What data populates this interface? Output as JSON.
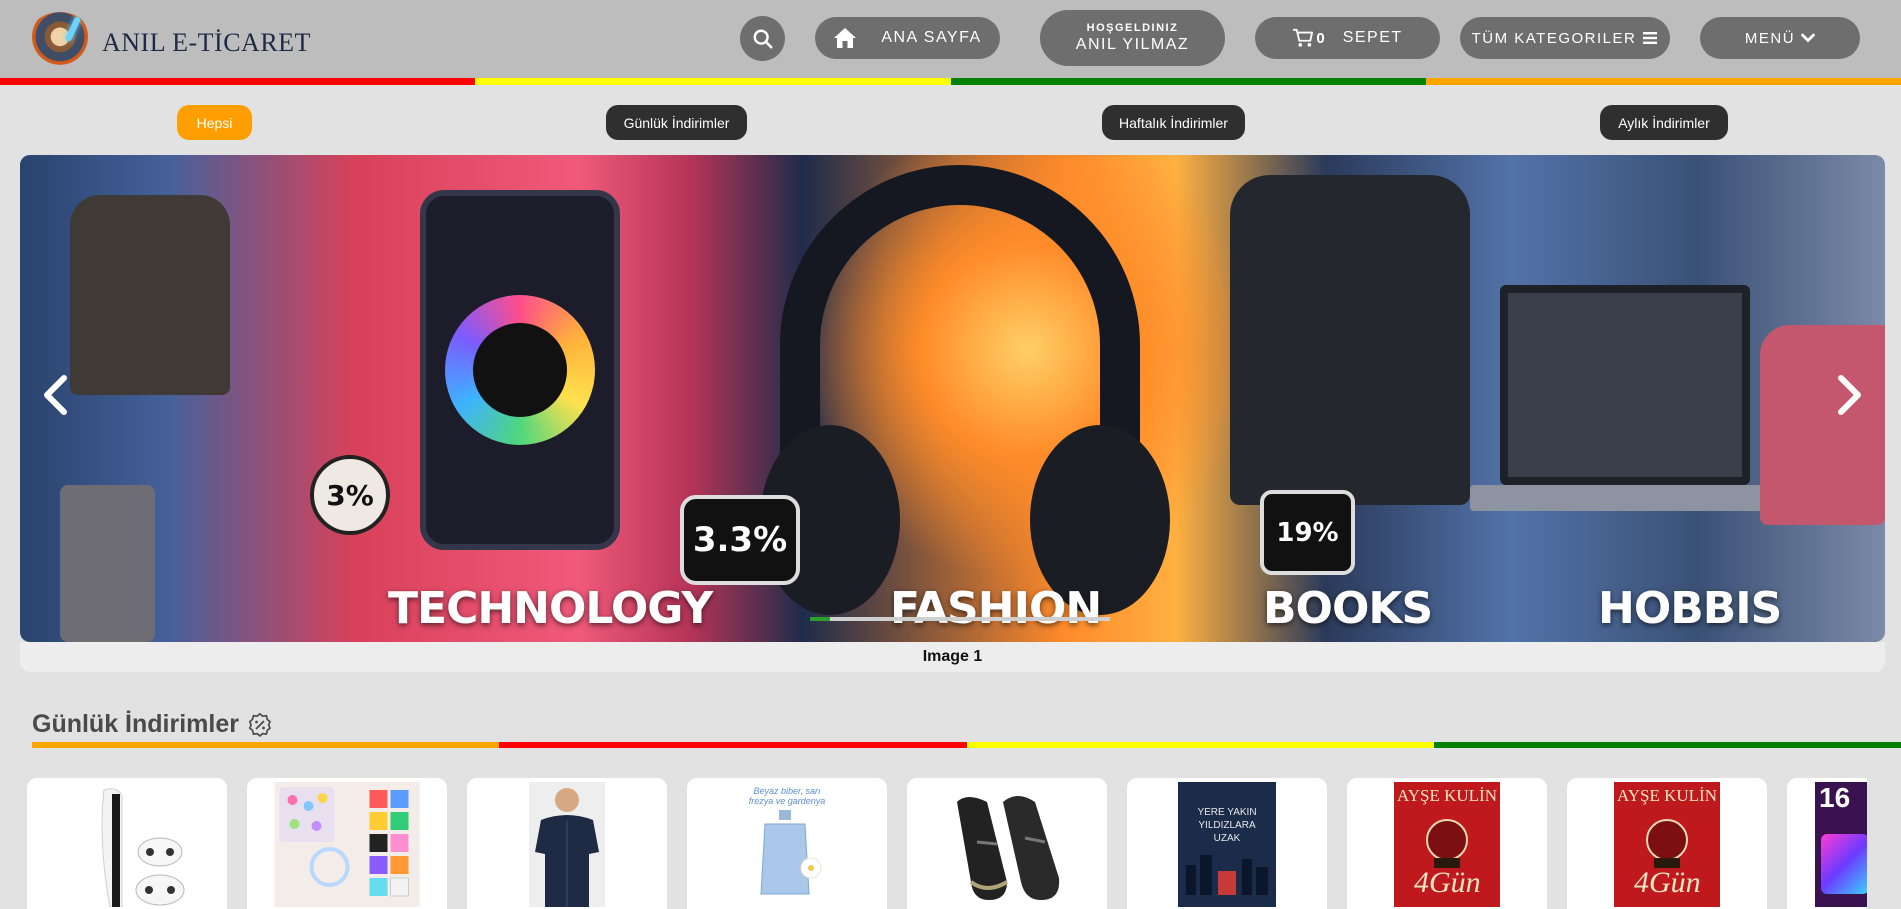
{
  "header": {
    "logo_text": "ANIL E-TİCARET",
    "nav": {
      "home_label": "ANA SAYFA",
      "welcome_line1": "HOŞGELDINIZ",
      "welcome_line2": "ANIL YILMAZ",
      "cart_count": "0",
      "cart_label": "SEPET",
      "categories_label": "TÜM KATEGORILER",
      "menu_label": "MENÜ"
    },
    "stripe_colors": [
      "#ff0000",
      "#ffff00",
      "#008000",
      "#ffa500"
    ]
  },
  "filters": {
    "tabs": [
      {
        "label": "Hepsi",
        "active": true
      },
      {
        "label": "Günlük İndirimler",
        "active": false
      },
      {
        "label": "Haftalık İndirimler",
        "active": false
      },
      {
        "label": "Aylık İndirimler",
        "active": false
      }
    ],
    "active_color": "#ff9e00",
    "inactive_color": "#2f2f2f"
  },
  "slider": {
    "badges": [
      "3%",
      "3.3%",
      "19%"
    ],
    "categories": [
      "TECHNOLOGY",
      "FASHION",
      "BOOKS",
      "HOBBIS"
    ],
    "caption": "Image 1"
  },
  "section": {
    "title": "Günlük İndirimler",
    "stripe_colors": [
      "#ffa500",
      "#ff0000",
      "#ffff00",
      "#008000"
    ]
  },
  "products": [
    {
      "image": "game-console"
    },
    {
      "image": "bead-kit"
    },
    {
      "image": "shirt"
    },
    {
      "image": "perfume",
      "text": "Beyaz biber, sarı frezya ve gardenya"
    },
    {
      "image": "shoes"
    },
    {
      "image": "book",
      "text": "YERE YAKIN YILDIZLARA UZAK"
    },
    {
      "image": "book",
      "text": "AYŞE KULİN"
    },
    {
      "image": "book",
      "text": "AYŞE KULİN"
    },
    {
      "image": "led-strip",
      "text": "16"
    }
  ]
}
